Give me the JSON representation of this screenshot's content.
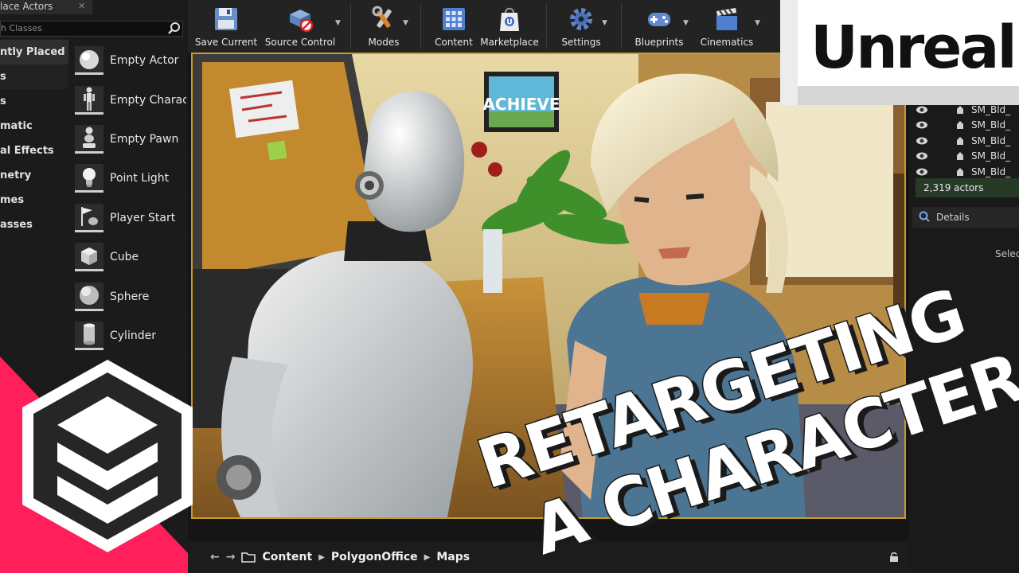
{
  "place_actors": {
    "tab_label": "lace Actors",
    "search_placeholder": "h Classes",
    "categories": [
      "ntly Placed",
      "s",
      "s",
      "matic",
      "al Effects",
      "netry",
      "mes",
      "asses"
    ],
    "items": [
      "Empty Actor",
      "Empty Charac",
      "Empty Pawn",
      "Point Light",
      "Player Start",
      "Cube",
      "Sphere",
      "Cylinder"
    ]
  },
  "toolbar": {
    "save_current": "Save Current",
    "source_control": "Source Control",
    "modes": "Modes",
    "content": "Content",
    "marketplace": "Marketplace",
    "settings": "Settings",
    "blueprints": "Blueprints",
    "cinematics": "Cinematics"
  },
  "viewport": {
    "poster_text": "ACHIEVE"
  },
  "outliner": {
    "rows": [
      "SM_Bld_",
      "SM_Bld_",
      "SM_Bld_",
      "SM_Bld_",
      "SM_Bld_"
    ],
    "actor_count": "2,319 actors"
  },
  "details": {
    "tab_label": "Details",
    "hint": "Selec"
  },
  "badge": {
    "text": "Unreal"
  },
  "title": {
    "line1": "RETARGETING",
    "line2": "A CHARACTER"
  },
  "content_browser": {
    "path": [
      "Content",
      "PolygonOffice",
      "Maps"
    ]
  },
  "colors": {
    "accent_pink": "#ff1f5a",
    "selection_gold": "#c89a2a",
    "panel_dark": "#1b1b1b"
  }
}
